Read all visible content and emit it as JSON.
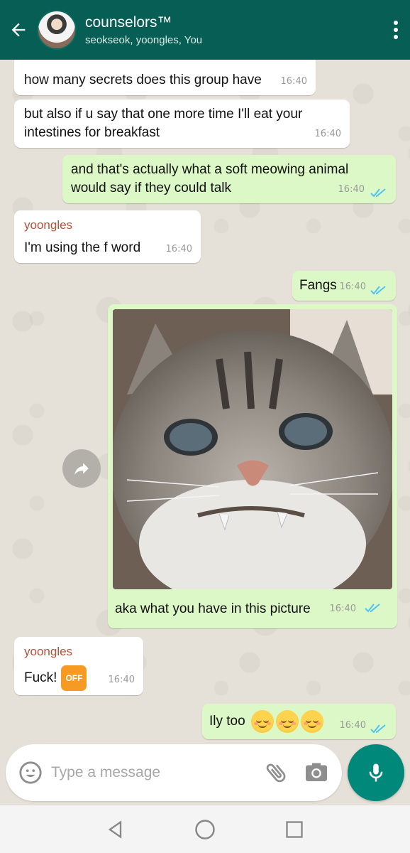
{
  "header": {
    "group_name": "counselors™",
    "participants": "seokseok, yoongles, You"
  },
  "messages": [
    {
      "text": "how many secrets does this group have",
      "time": "16:40"
    },
    {
      "text": "but also if u say that one more time I'll eat your intestines for breakfast",
      "time": "16:40"
    },
    {
      "text": "and that's actually what a soft meowing animal would say if they could talk",
      "time": "16:40"
    },
    {
      "sender": "yoongles",
      "text": "I'm using the f word",
      "time": "16:40"
    },
    {
      "text": "Fangs",
      "time": "16:40"
    },
    {
      "caption": "aka what you have in this picture",
      "time": "16:40"
    },
    {
      "sender": "yoongles",
      "text": "Fuck!",
      "icon_text": "OFF",
      "time": "16:40"
    },
    {
      "text": "Ily too",
      "time": "16:40"
    }
  ],
  "input": {
    "placeholder": "Type a message"
  },
  "colors": {
    "header": "#075e54",
    "outgoing_bubble": "#dcf8c6",
    "incoming_bubble": "#ffffff",
    "sender_name": "#b5503a",
    "read_ticks": "#4fc3f7",
    "mic_button": "#00897b"
  },
  "icons": {
    "back": "arrow-left-icon",
    "menu": "more-vert-icon",
    "emoji": "emoji-icon",
    "attach": "paperclip-icon",
    "camera": "camera-icon",
    "mic": "mic-icon",
    "forward": "forward-icon",
    "nav_back": "triangle-back-icon",
    "nav_home": "circle-home-icon",
    "nav_recents": "square-recents-icon"
  }
}
